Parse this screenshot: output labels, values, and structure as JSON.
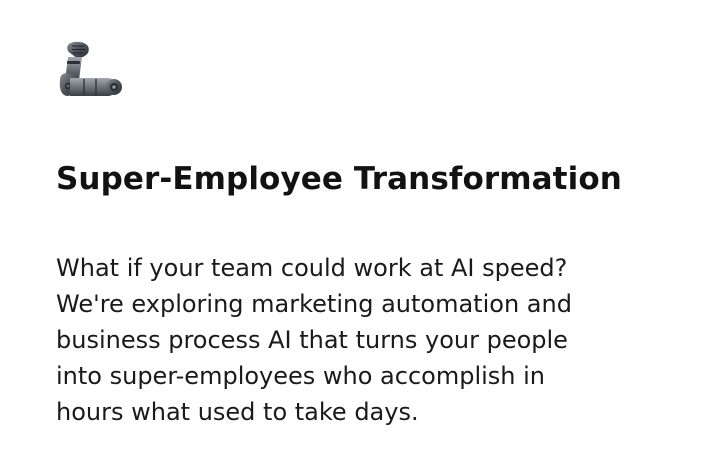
{
  "card": {
    "icon": "mechanical-arm-icon",
    "title": "Super-Employee Transformation",
    "description_lines": [
      "What if your team could work at AI speed?",
      "We're exploring marketing automation and",
      "business process AI that turns your people",
      "into super-employees who accomplish in",
      "hours what used to take days."
    ]
  }
}
